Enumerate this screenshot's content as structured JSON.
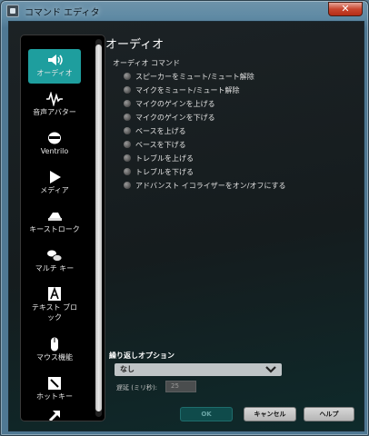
{
  "window": {
    "title": "コマンド エディタ",
    "close_label": "✕"
  },
  "sidebar": {
    "items": [
      {
        "label": "オーディオ",
        "icon": "speaker-icon",
        "active": true
      },
      {
        "label": "音声アバター",
        "icon": "waveform-icon",
        "active": false
      },
      {
        "label": "Ventrilo",
        "icon": "ventrilo-icon",
        "active": false
      },
      {
        "label": "メディア",
        "icon": "play-icon",
        "active": false
      },
      {
        "label": "キーストローク",
        "icon": "key-icon",
        "active": false
      },
      {
        "label": "マルチ キー",
        "icon": "multi-key-icon",
        "active": false
      },
      {
        "label": "テキスト ブロック",
        "icon": "text-block-icon",
        "active": false
      },
      {
        "label": "マウス機能",
        "icon": "mouse-icon",
        "active": false
      },
      {
        "label": "ホットキー",
        "icon": "hotkey-icon",
        "active": false
      },
      {
        "label": "",
        "icon": "shortcut-arrow-icon",
        "active": false
      }
    ]
  },
  "main": {
    "title": "オーディオ",
    "section_title": "オーディオ コマンド",
    "commands": [
      "スピーカーをミュート/ミュート解除",
      "マイクをミュート/ミュート解除",
      "マイクのゲインを上げる",
      "マイクのゲインを下げる",
      "ベースを上げる",
      "ベースを下げる",
      "トレブルを上げる",
      "トレブルを下げる",
      "アドバンスト イコライザーをオン/オフにする"
    ]
  },
  "repeat": {
    "title": "繰り返しオプション",
    "selected": "なし",
    "delay_label": "遅延 (ミリ秒):",
    "delay_value": "25"
  },
  "buttons": {
    "ok": "OK",
    "cancel": "キャンセル",
    "help": "ヘルプ"
  },
  "colors": {
    "accent": "#1e9e9e",
    "background": "#151c1e"
  }
}
